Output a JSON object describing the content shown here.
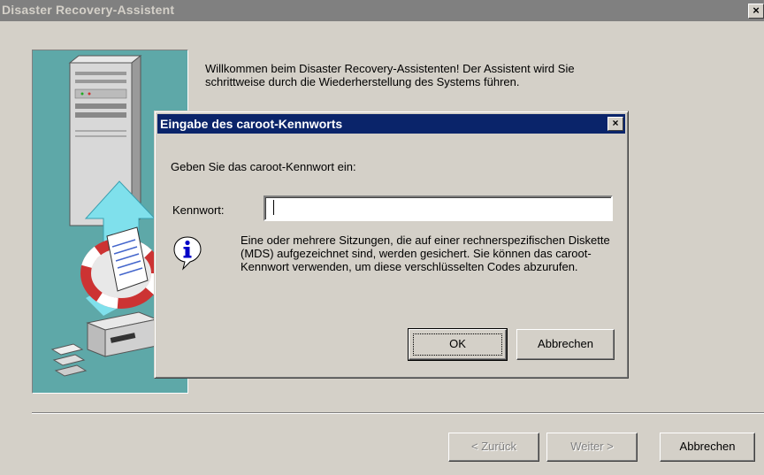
{
  "window": {
    "title": "Disaster Recovery-Assistent",
    "close_glyph": "×"
  },
  "welcome_text": "Willkommen beim Disaster Recovery-Assistenten! Der Assistent wird Sie schrittweise durch die Wiederherstellung des Systems führen.",
  "footer": {
    "back_label": "< Zurück",
    "next_label": "Weiter >",
    "cancel_label": "Abbrechen"
  },
  "dialog": {
    "title": "Eingabe des caroot-Kennworts",
    "close_glyph": "×",
    "prompt": "Geben Sie das caroot-Kennwort ein:",
    "password_label": "Kennwort:",
    "password_value": "",
    "info_text": "Eine oder mehrere Sitzungen, die auf einer rechnerspezifischen Diskette (MDS) aufgezeichnet sind, werden gesichert. Sie können das caroot-Kennwort verwenden, um diese verschlüsselten Codes abzurufen.",
    "ok_label": "OK",
    "cancel_label": "Abbrechen"
  },
  "icons": {
    "info": "info-icon",
    "illustration": "disaster-recovery-illustration"
  },
  "colors": {
    "window_bg": "#d4d0c8",
    "inactive_title": "#808080",
    "active_title": "#0a246a",
    "panel_teal": "#5ea8a8"
  }
}
